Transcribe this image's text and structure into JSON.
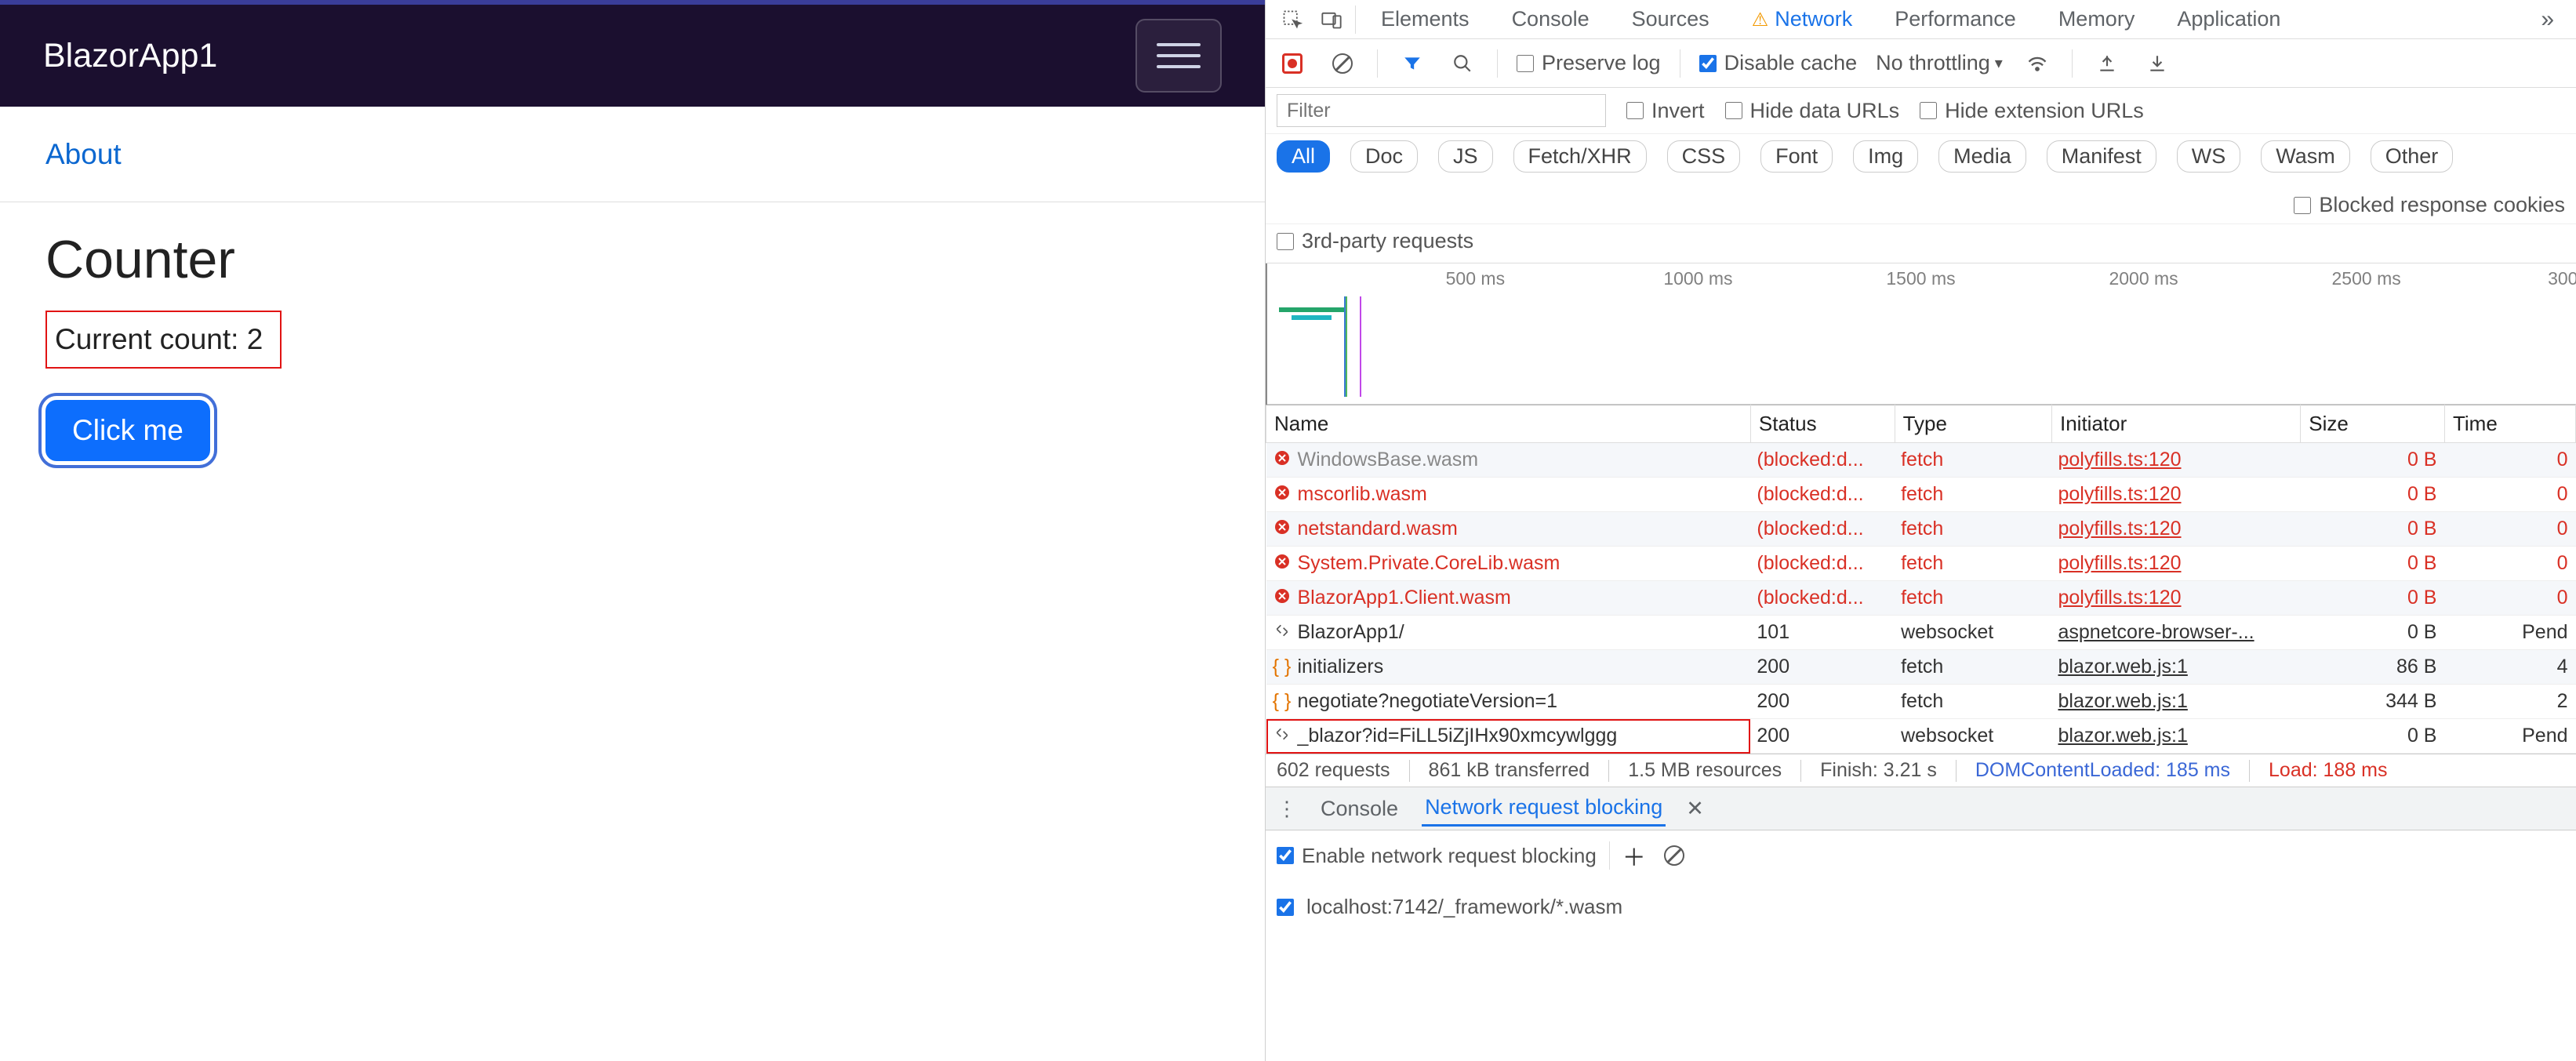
{
  "app": {
    "brand": "BlazorApp1",
    "about": "About",
    "title": "Counter",
    "count_label": "Current count: 2",
    "button": "Click me"
  },
  "devtools": {
    "tabs": [
      "Elements",
      "Console",
      "Sources",
      "Network",
      "Performance",
      "Memory",
      "Application"
    ],
    "active_tab": "Network",
    "toolbar": {
      "preserve_log": "Preserve log",
      "disable_cache": "Disable cache",
      "throttling": "No throttling"
    },
    "filter": {
      "placeholder": "Filter",
      "invert": "Invert",
      "hide_data_urls": "Hide data URLs",
      "hide_ext_urls": "Hide extension URLs"
    },
    "pills": [
      "All",
      "Doc",
      "JS",
      "Fetch/XHR",
      "CSS",
      "Font",
      "Img",
      "Media",
      "Manifest",
      "WS",
      "Wasm",
      "Other"
    ],
    "blocked_cookies": "Blocked response cookies",
    "third_party": "3rd-party requests",
    "timeline_ticks": [
      "500 ms",
      "1000 ms",
      "1500 ms",
      "2000 ms",
      "2500 ms",
      "300"
    ],
    "columns": [
      "Name",
      "Status",
      "Type",
      "Initiator",
      "Size",
      "Time"
    ],
    "rows": [
      {
        "err": true,
        "partial": true,
        "icon": "err",
        "name": "WindowsBase.wasm",
        "status": "(blocked:d...",
        "type": "fetch",
        "initiator": "polyfills.ts:120",
        "size": "0 B",
        "time": "0"
      },
      {
        "err": true,
        "icon": "err",
        "name": "mscorlib.wasm",
        "status": "(blocked:d...",
        "type": "fetch",
        "initiator": "polyfills.ts:120",
        "size": "0 B",
        "time": "0"
      },
      {
        "err": true,
        "icon": "err",
        "name": "netstandard.wasm",
        "status": "(blocked:d...",
        "type": "fetch",
        "initiator": "polyfills.ts:120",
        "size": "0 B",
        "time": "0"
      },
      {
        "err": true,
        "icon": "err",
        "name": "System.Private.CoreLib.wasm",
        "status": "(blocked:d...",
        "type": "fetch",
        "initiator": "polyfills.ts:120",
        "size": "0 B",
        "time": "0"
      },
      {
        "err": true,
        "icon": "err",
        "name": "BlazorApp1.Client.wasm",
        "status": "(blocked:d...",
        "type": "fetch",
        "initiator": "polyfills.ts:120",
        "size": "0 B",
        "time": "0"
      },
      {
        "err": false,
        "icon": "ws",
        "name": "BlazorApp1/",
        "status": "101",
        "type": "websocket",
        "initiator": "aspnetcore-browser-...",
        "size": "0 B",
        "time": "Pend"
      },
      {
        "err": false,
        "icon": "json",
        "name": "initializers",
        "status": "200",
        "type": "fetch",
        "initiator": "blazor.web.js:1",
        "size": "86 B",
        "time": "4"
      },
      {
        "err": false,
        "icon": "json",
        "name": "negotiate?negotiateVersion=1",
        "status": "200",
        "type": "fetch",
        "initiator": "blazor.web.js:1",
        "size": "344 B",
        "time": "2"
      },
      {
        "err": false,
        "icon": "ws",
        "hl": true,
        "name": "_blazor?id=FiLL5iZjIHx90xmcywlggg",
        "status": "200",
        "type": "websocket",
        "initiator": "blazor.web.js:1",
        "size": "0 B",
        "time": "Pend"
      }
    ],
    "summary": {
      "requests": "602 requests",
      "transferred": "861 kB transferred",
      "resources": "1.5 MB resources",
      "finish": "Finish: 3.21 s",
      "dcl": "DOMContentLoaded: 185 ms",
      "load": "Load: 188 ms"
    },
    "drawer": {
      "tabs": [
        "Console",
        "Network request blocking"
      ],
      "enable": "Enable network request blocking",
      "pattern": "localhost:7142/_framework/*.wasm"
    }
  }
}
